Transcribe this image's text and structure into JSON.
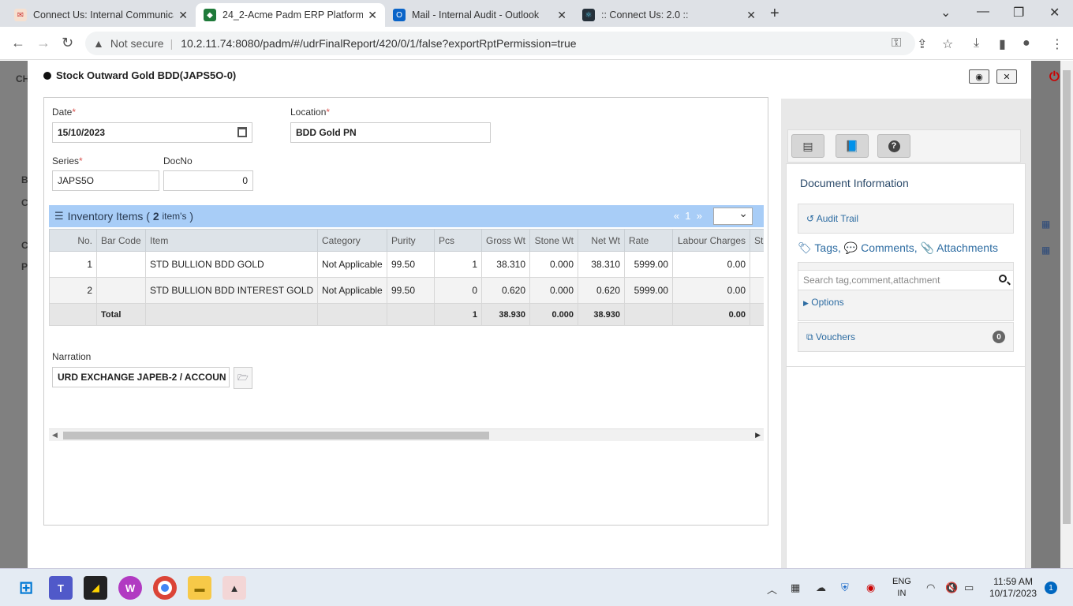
{
  "browser": {
    "tabs": [
      {
        "label": "Connect Us: Internal Communica",
        "active": false
      },
      {
        "label": "24_2-Acme Padm ERP Platform",
        "active": true
      },
      {
        "label": "Mail - Internal Audit - Outlook",
        "active": false
      },
      {
        "label": ":: Connect Us: 2.0 ::",
        "active": false
      }
    ],
    "security": "Not secure",
    "url": "10.2.11.74:8080/padm/#/udrFinalReport/420/0/1/false?exportRptPermission=true"
  },
  "background": {
    "left_labels": [
      "CH",
      "B",
      "C",
      "C",
      "P"
    ]
  },
  "modal": {
    "title": "Stock Outward Gold BDD(JAPS5O-0)",
    "form": {
      "date_label": "Date",
      "date_value": "15/10/2023",
      "location_label": "Location",
      "location_value": "BDD Gold PN",
      "series_label": "Series",
      "series_value": "JAPS5O",
      "docno_label": "DocNo",
      "docno_value": "0",
      "required_mark": "*"
    },
    "inventory": {
      "title": "Inventory Items (",
      "count": "2",
      "count_suffix": "item's",
      "close_paren": ")",
      "pager_prev": "«",
      "pager_page": "1",
      "pager_next": "»",
      "columns": [
        "No.",
        "Bar Code",
        "Item",
        "Category",
        "Purity",
        "Pcs",
        "Gross Wt",
        "Stone Wt",
        "Net Wt",
        "Rate",
        "Labour Charges",
        "St"
      ],
      "rows": [
        {
          "no": "1",
          "barcode": "",
          "item": "STD BULLION BDD GOLD",
          "category": "Not Applicable",
          "purity": "99.50",
          "pcs": "1",
          "gross": "38.310",
          "stone": "0.000",
          "net": "38.310",
          "rate": "5999.00",
          "labour": "0.00"
        },
        {
          "no": "2",
          "barcode": "",
          "item": "STD BULLION BDD INTEREST GOLD",
          "category": "Not Applicable",
          "purity": "99.50",
          "pcs": "0",
          "gross": "0.620",
          "stone": "0.000",
          "net": "0.620",
          "rate": "5999.00",
          "labour": "0.00"
        }
      ],
      "total": {
        "label": "Total",
        "pcs": "1",
        "gross": "38.930",
        "stone": "0.000",
        "net": "38.930",
        "labour": "0.00"
      }
    },
    "narration_label": "Narration",
    "narration_value": "URD EXCHANGE JAPEB-2 / ACCOUN"
  },
  "info_panel": {
    "title": "Document Information",
    "audit_trail": "Audit Trail",
    "tags": "Tags,",
    "comments": "Comments,",
    "attachments": "Attachments",
    "search_placeholder": "Search tag,comment,attachment",
    "options": "Options",
    "vouchers": "Vouchers",
    "vouchers_count": "0"
  },
  "taskbar": {
    "lang_top": "ENG",
    "lang_bottom": "IN",
    "time": "11:59 AM",
    "date": "10/17/2023",
    "notifications": "1"
  }
}
